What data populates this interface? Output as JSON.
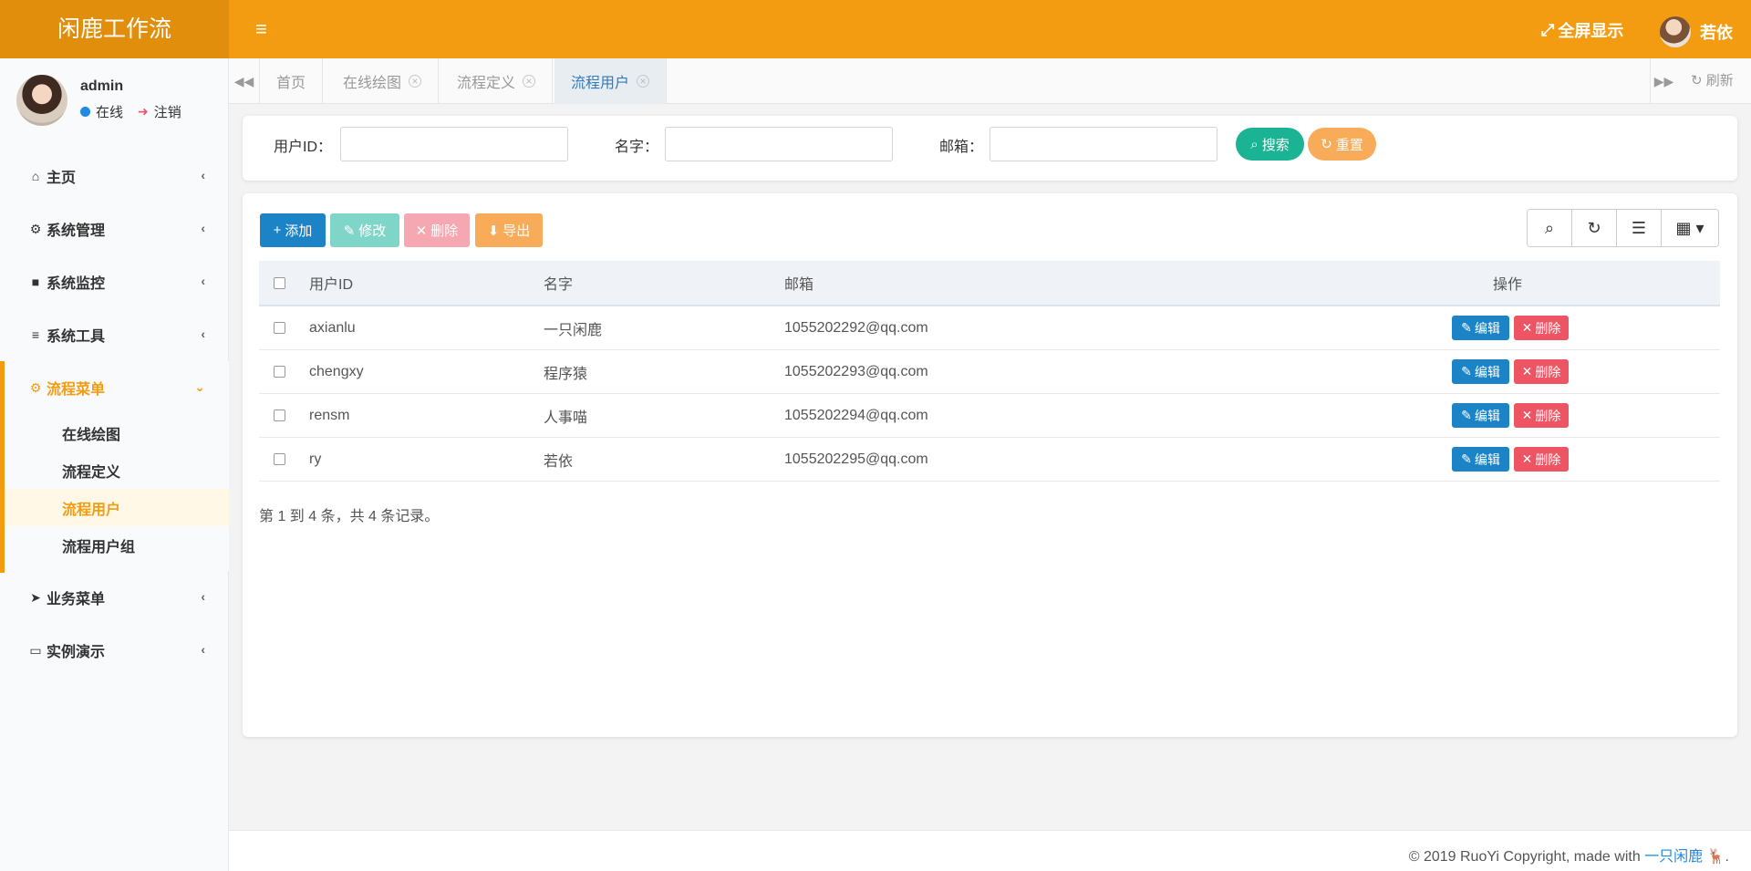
{
  "header": {
    "brand": "闲鹿工作流",
    "fullscreen_label": "全屏显示",
    "user_name": "若依",
    "menu_toggle_icon": "bars-icon"
  },
  "sidebar": {
    "username": "admin",
    "status_online": "在线",
    "logout": "注销",
    "items": [
      {
        "label": "主页",
        "icon": "home-icon"
      },
      {
        "label": "系统管理",
        "icon": "gear-icon"
      },
      {
        "label": "系统监控",
        "icon": "video-icon"
      },
      {
        "label": "系统工具",
        "icon": "bars-icon"
      },
      {
        "label": "流程菜单",
        "icon": "cogs-icon"
      },
      {
        "label": "业务菜单",
        "icon": "send-icon"
      },
      {
        "label": "实例演示",
        "icon": "desktop-icon"
      }
    ],
    "sub_items": [
      "在线绘图",
      "流程定义",
      "流程用户",
      "流程用户组"
    ]
  },
  "tabs": {
    "items": [
      "首页",
      "在线绘图",
      "流程定义",
      "流程用户"
    ],
    "refresh": "刷新"
  },
  "search": {
    "user_id_label": "用户ID：",
    "name_label": "名字：",
    "email_label": "邮箱：",
    "search_button": "搜索",
    "reset_button": "重置"
  },
  "toolbar": {
    "add": "添加",
    "edit": "修改",
    "delete": "删除",
    "export": "导出"
  },
  "table": {
    "headers": {
      "user_id": "用户ID",
      "name": "名字",
      "email": "邮箱",
      "actions": "操作"
    },
    "rows": [
      {
        "user_id": "axianlu",
        "name": "一只闲鹿",
        "email": "1055202292@qq.com"
      },
      {
        "user_id": "chengxy",
        "name": "程序猿",
        "email": "1055202293@qq.com"
      },
      {
        "user_id": "rensm",
        "name": "人事喵",
        "email": "1055202294@qq.com"
      },
      {
        "user_id": "ry",
        "name": "若依",
        "email": "1055202295@qq.com"
      }
    ],
    "row_edit": "编辑",
    "row_delete": "删除",
    "pagination_info": "第 1 到 4 条，共 4 条记录。"
  },
  "footer": {
    "text": "© 2019 RuoYi Copyright, made with ",
    "link": "一只闲鹿",
    "suffix": "."
  },
  "colors": {
    "primary_orange": "#f39c12",
    "brand_dark_orange": "#e08e0b",
    "blue": "#1f8ae0",
    "teal": "#1ab394",
    "red": "#ed5565"
  }
}
